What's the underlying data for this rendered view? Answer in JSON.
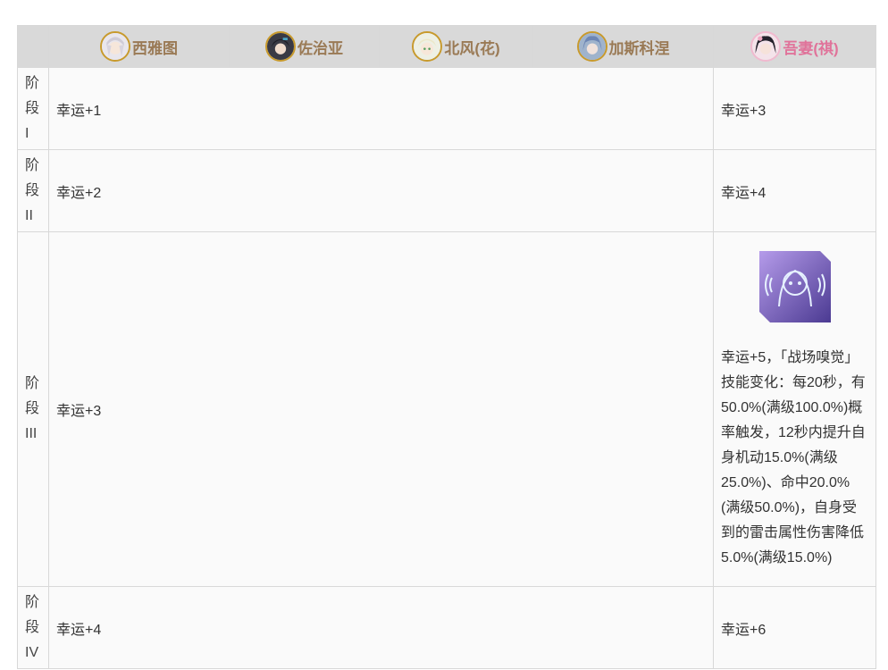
{
  "headers": [
    {
      "name": "西雅图",
      "avatar_icon": "seattle-avatar-icon"
    },
    {
      "name": "佐治亚",
      "avatar_icon": "georgia-avatar-icon"
    },
    {
      "name": "北风(花)",
      "avatar_icon": "kitakaze-avatar-icon"
    },
    {
      "name": "加斯科涅",
      "avatar_icon": "gascogne-avatar-icon"
    },
    {
      "name": "吾妻(祺)",
      "avatar_icon": "azuma-avatar-icon"
    }
  ],
  "rows": [
    {
      "stage": [
        "阶",
        "段",
        "I"
      ],
      "shared": "幸运+1",
      "azuma": "幸运+3"
    },
    {
      "stage": [
        "阶",
        "段",
        "II"
      ],
      "shared": "幸运+2",
      "azuma": "幸运+4"
    },
    {
      "stage": [
        "阶",
        "段",
        "III"
      ],
      "shared": "幸运+3",
      "azuma_icon": "battlefield-sense-skill-icon",
      "azuma": "幸运+5，「战场嗅觉」技能变化：每20秒，有50.0%(满级100.0%)概率触发，12秒内提升自身机动15.0%(满级25.0%)、命中20.0%(满级50.0%)，自身受到的雷击属性伤害降低5.0%(满级15.0%)"
    },
    {
      "stage": [
        "阶",
        "段",
        "IV"
      ],
      "shared": "幸运+4",
      "azuma": "幸运+6"
    }
  ],
  "colors": {
    "header_bg": "#d9d9d9",
    "header_text": "#9a7a55",
    "highlight_text": "#e0739a",
    "avatar_ring": "#c89a2c"
  }
}
